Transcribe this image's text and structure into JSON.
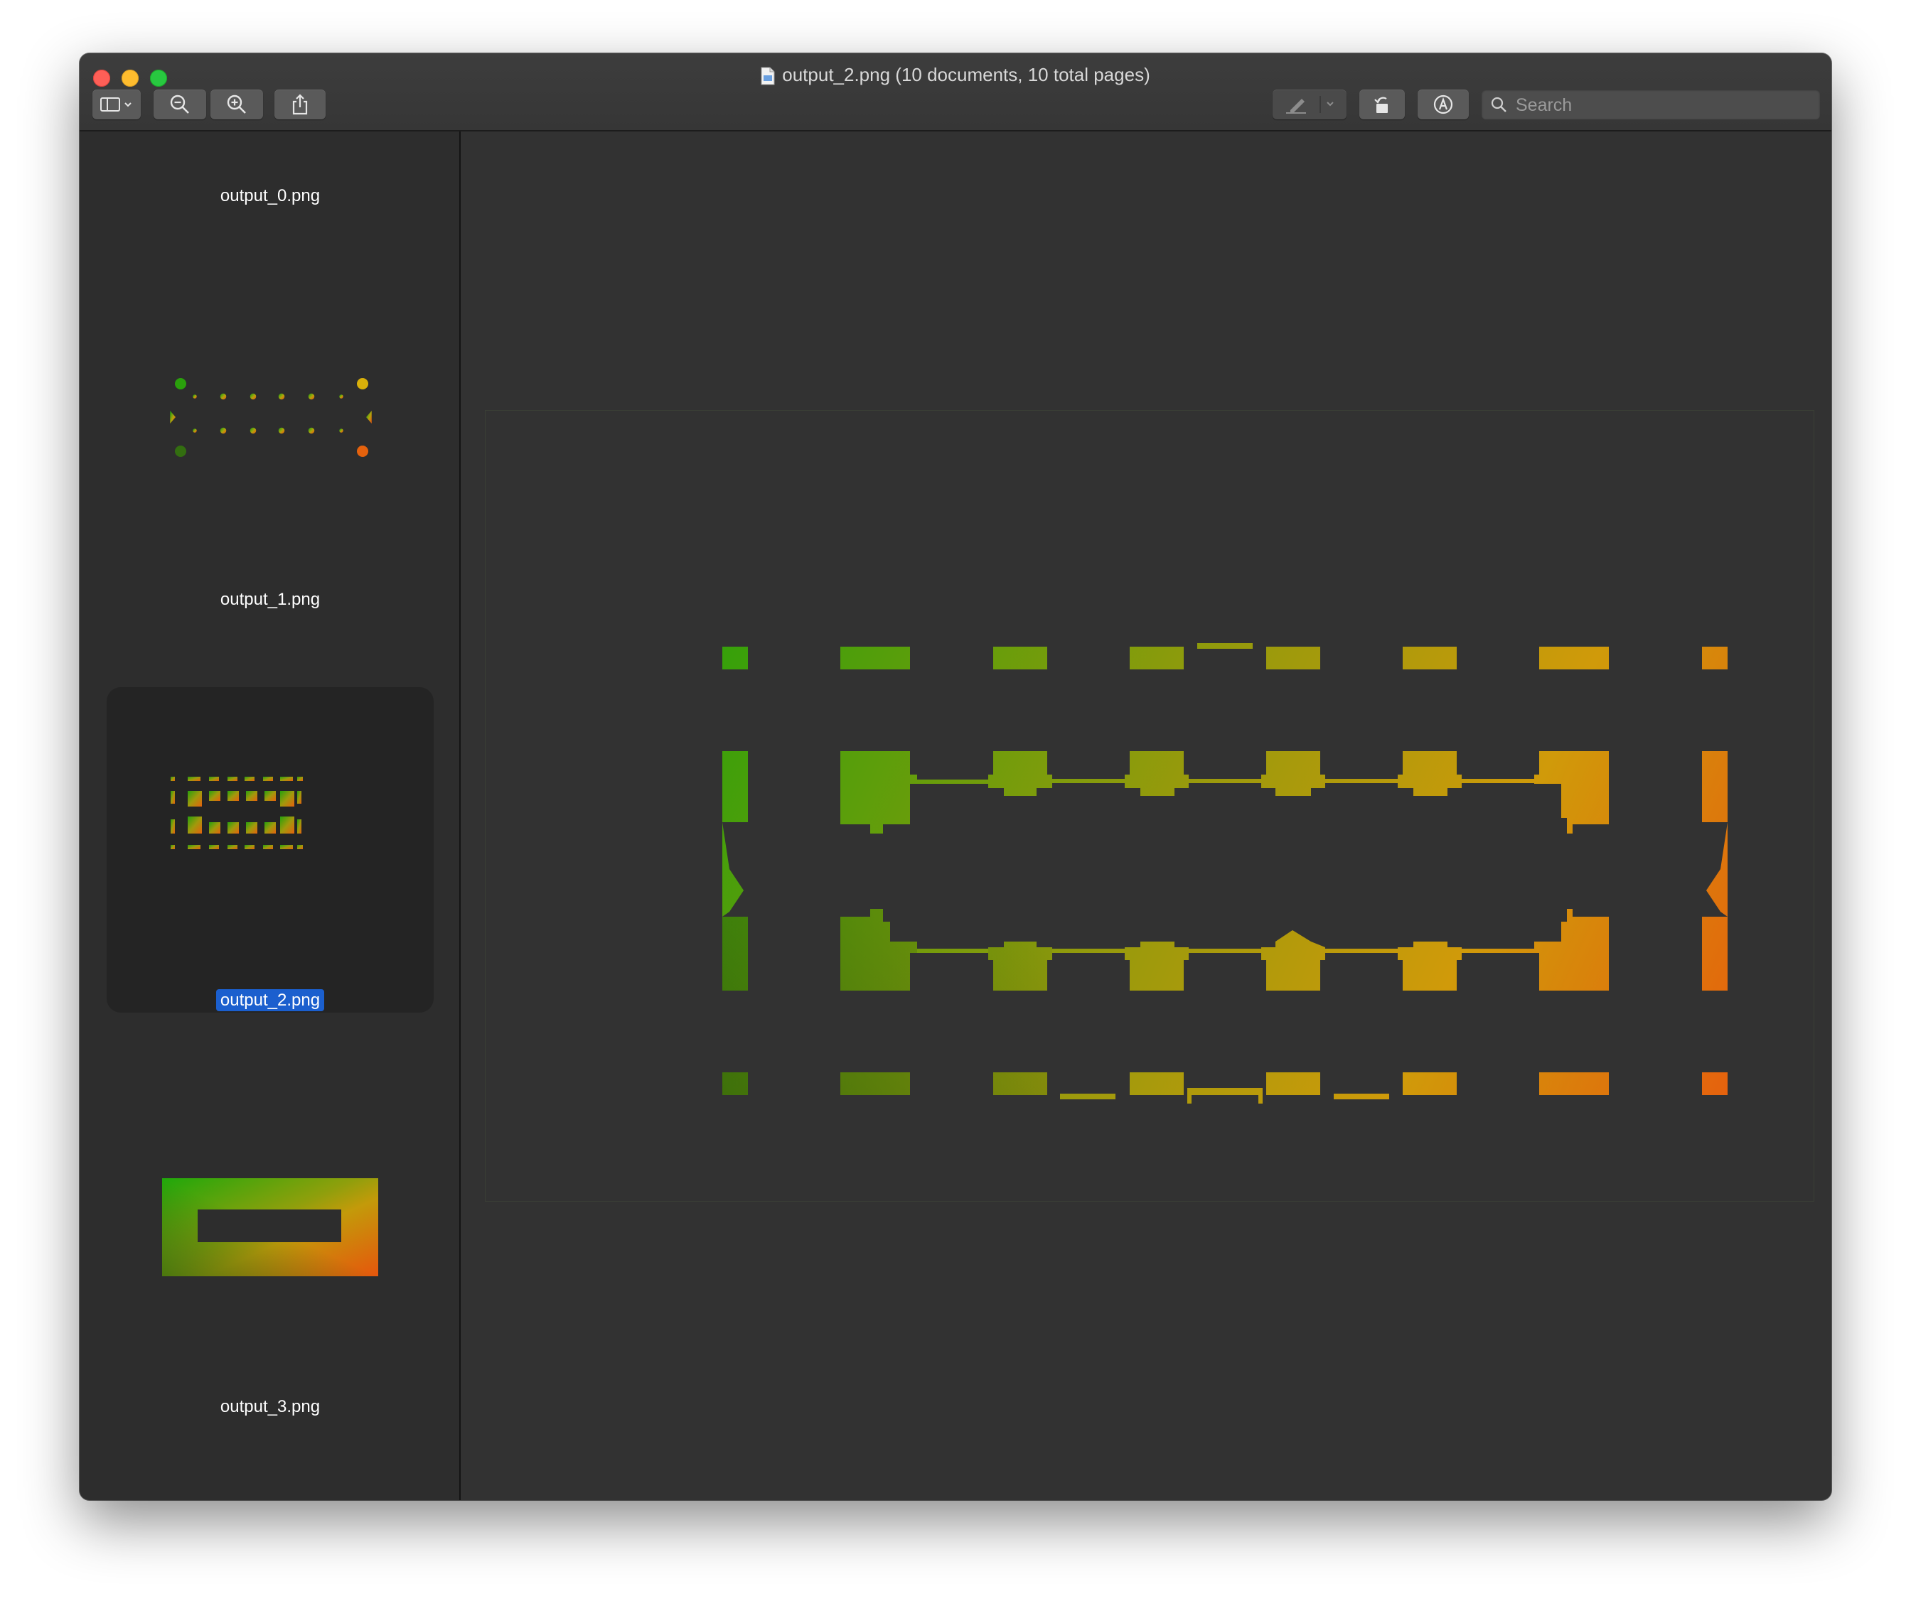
{
  "window": {
    "title": "output_2.png (10 documents, 10 total pages)"
  },
  "toolbar": {
    "sidebar_toggle_icon": "sidebar-toggle-icon",
    "zoom_out_icon": "zoom-out-icon",
    "zoom_in_icon": "zoom-in-icon",
    "share_icon": "share-icon",
    "markup_pen_icon": "pen-icon",
    "rotate_icon": "rotate-icon",
    "annotate_icon": "markup-icon"
  },
  "search": {
    "placeholder": "Search",
    "value": ""
  },
  "sidebar": {
    "items": [
      {
        "label": "output_0.png",
        "selected": false
      },
      {
        "label": "output_1.png",
        "selected": false
      },
      {
        "label": "output_2.png",
        "selected": true
      },
      {
        "label": "output_3.png",
        "selected": false
      }
    ]
  },
  "colors": {
    "accent_selection": "#1b5fce",
    "gradient_green": "#22a10a",
    "gradient_yellow": "#d7b20a",
    "gradient_orange": "#e5620d",
    "gradient_dark_green": "#2e6a0f"
  }
}
